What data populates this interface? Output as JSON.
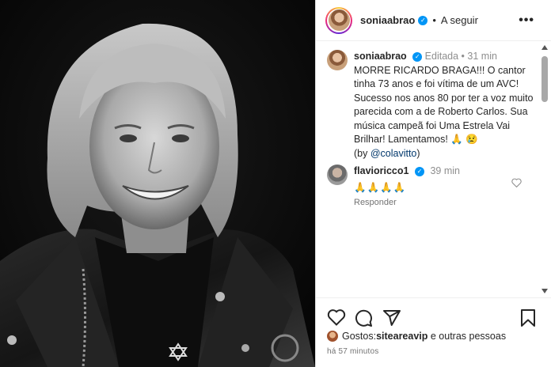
{
  "header": {
    "username": "soniaabrao",
    "separator": "•",
    "follow_label": "A seguir",
    "more_label": "•••"
  },
  "caption": {
    "username": "soniaabrao",
    "edited_label": "Editada",
    "dot": "•",
    "time": "31 min",
    "text": "MORRE RICARDO BRAGA!!! O cantor tinha 73 anos e foi vítima de um AVC! Sucesso nos anos 80 por ter a voz muito parecida com a de Roberto Carlos. Sua música campeã foi Uma Estrela Vai Brilhar! Lamentamos! 🙏 😢",
    "credit_prefix": "(by ",
    "mention": "@colavitto",
    "credit_suffix": ")"
  },
  "comment": {
    "username": "flavioricco1",
    "time": "39 min",
    "text": "🙏🙏🙏🙏",
    "reply_label": "Responder"
  },
  "likes": {
    "prefix": "Gostos: ",
    "user": "siteareavip",
    "suffix": " e outras pessoas"
  },
  "timestamp": "há 57 minutos",
  "colors": {
    "verified": "#0095f6",
    "mention": "#00376b",
    "muted": "#8e8e8e"
  },
  "icons": [
    "more-options-icon",
    "verified-badge-icon",
    "heart-icon",
    "comment-icon",
    "share-icon",
    "bookmark-icon"
  ]
}
